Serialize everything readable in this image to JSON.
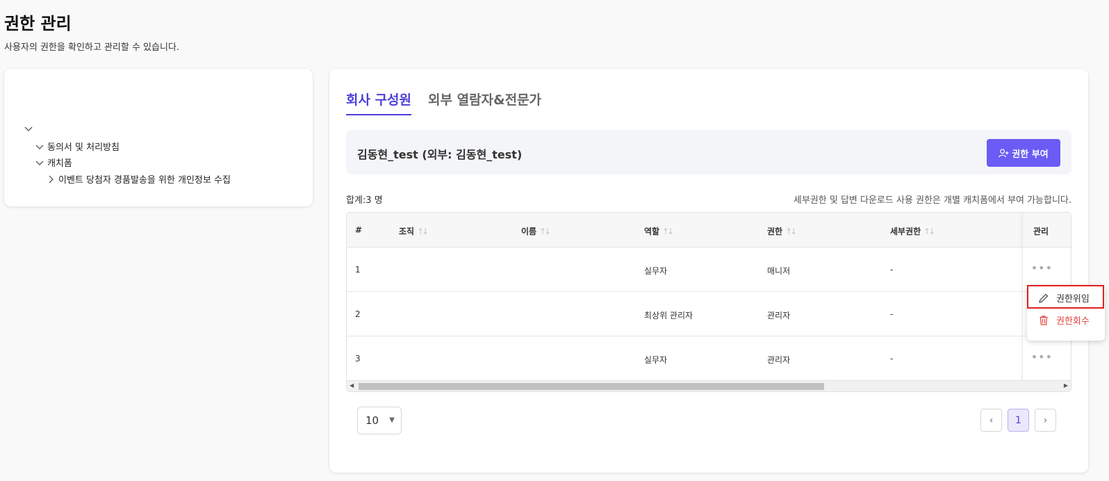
{
  "header": {
    "title": "권한 관리",
    "subtitle": "사용자의 권한을 확인하고 관리할 수 있습니다."
  },
  "tree": {
    "items": [
      {
        "label": "",
        "level": 0,
        "expanded": true
      },
      {
        "label": "동의서 및 처리방침",
        "level": 1,
        "expanded": true
      },
      {
        "label": "캐치폼",
        "level": 1,
        "expanded": true
      },
      {
        "label": "이벤트 당첨자 경품발송을 위한 개인정보 수집",
        "level": 2,
        "expanded": false
      }
    ]
  },
  "tabs": [
    {
      "label": "회사 구성원",
      "active": true
    },
    {
      "label": "외부 열람자&전문가",
      "active": false
    }
  ],
  "user_bar": {
    "name": "김동현_test (외부: 김동현_test)",
    "grant_button": "권한 부여"
  },
  "summary": {
    "total": "합계:3 명",
    "notice": "세부권한 및 답변 다운로드 사용 권한은 개별 캐치폼에서 부여 가능합니다."
  },
  "table": {
    "columns": [
      "#",
      "조직",
      "이름",
      "역할",
      "권한",
      "세부권한",
      "관리"
    ],
    "rows": [
      {
        "num": "1",
        "org": "",
        "name": "",
        "role": "실무자",
        "perm": "매니저",
        "detail": "-"
      },
      {
        "num": "2",
        "org": "",
        "name": "",
        "role": "최상위 관리자",
        "perm": "관리자",
        "detail": "-"
      },
      {
        "num": "3",
        "org": "",
        "name": "",
        "role": "실무자",
        "perm": "관리자",
        "detail": "-"
      }
    ]
  },
  "pagination": {
    "page_size": "10",
    "current_page": "1",
    "prev": "‹",
    "next": "›"
  },
  "context_menu": {
    "delegate": "권한위임",
    "revoke": "권한회수"
  },
  "colors": {
    "accent": "#6a5cf4",
    "active_tab": "#4b3fd9",
    "danger": "#e0413a",
    "highlight": "#e02020"
  }
}
